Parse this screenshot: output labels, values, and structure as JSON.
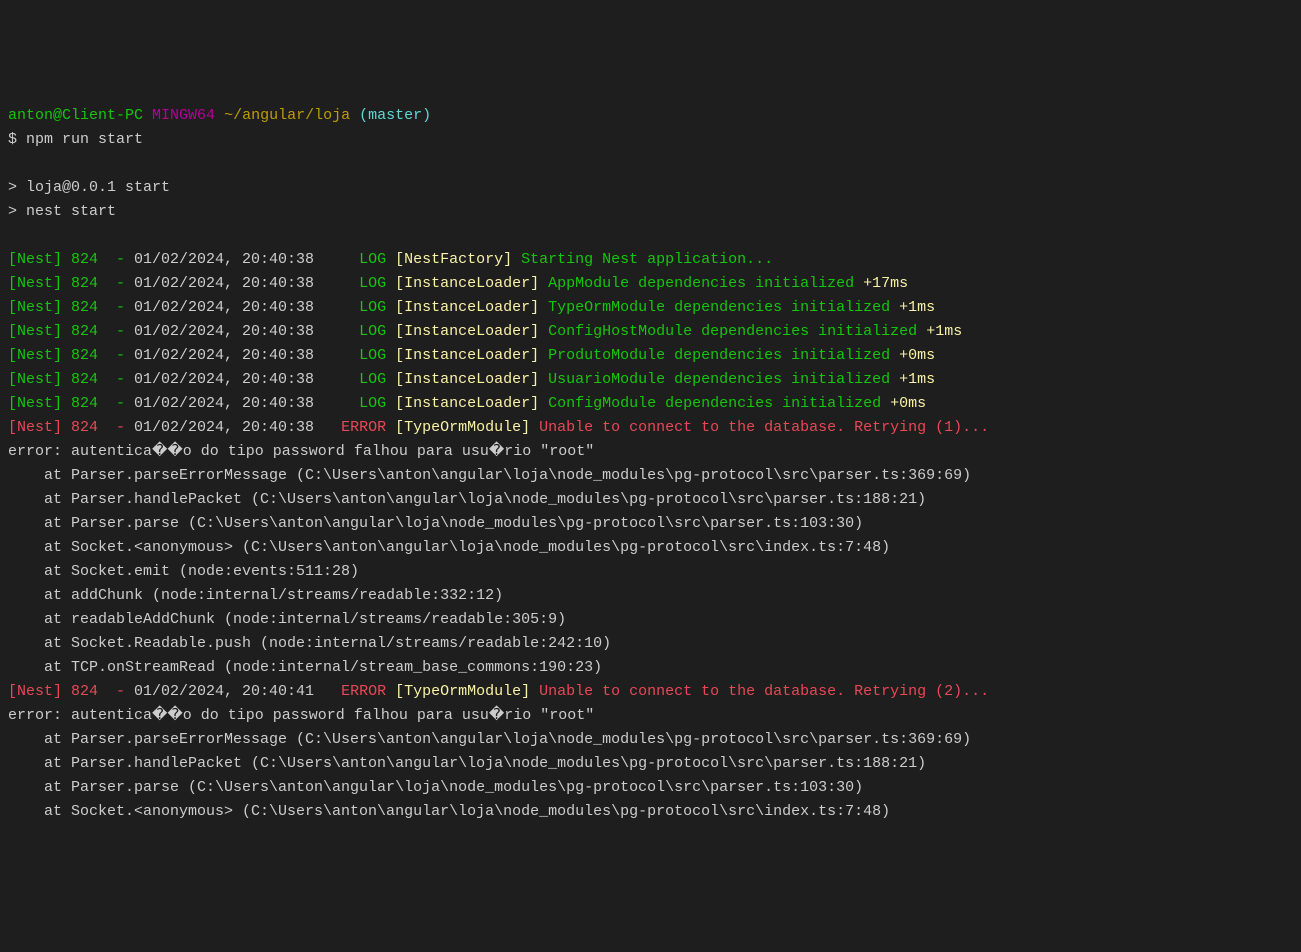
{
  "prompt": {
    "user": "anton@Client-PC",
    "mingw": "MINGW64",
    "path": "~/angular/loja",
    "branch": "(master)",
    "cmd_prefix": "$ ",
    "command": "npm run start"
  },
  "npm_output": "\n> loja@0.0.1 start\n> nest start\n",
  "logs": [
    {
      "prefix": "[Nest] 824  - ",
      "date": "01/02/2024, 20:40:38",
      "level": "     LOG ",
      "level_color": "green",
      "context": "[NestFactory]",
      "context_color": "yellow-bright",
      "msg": " Starting Nest application...",
      "msg_color": "green",
      "time": ""
    },
    {
      "prefix": "[Nest] 824  - ",
      "date": "01/02/2024, 20:40:38",
      "level": "     LOG ",
      "level_color": "green",
      "context": "[InstanceLoader]",
      "context_color": "yellow-bright",
      "msg": " AppModule dependencies initialized ",
      "msg_color": "green",
      "time": "+17ms"
    },
    {
      "prefix": "[Nest] 824  - ",
      "date": "01/02/2024, 20:40:38",
      "level": "     LOG ",
      "level_color": "green",
      "context": "[InstanceLoader]",
      "context_color": "yellow-bright",
      "msg": " TypeOrmModule dependencies initialized ",
      "msg_color": "green",
      "time": "+1ms"
    },
    {
      "prefix": "[Nest] 824  - ",
      "date": "01/02/2024, 20:40:38",
      "level": "     LOG ",
      "level_color": "green",
      "context": "[InstanceLoader]",
      "context_color": "yellow-bright",
      "msg": " ConfigHostModule dependencies initialized ",
      "msg_color": "green",
      "time": "+1ms"
    },
    {
      "prefix": "[Nest] 824  - ",
      "date": "01/02/2024, 20:40:38",
      "level": "     LOG ",
      "level_color": "green",
      "context": "[InstanceLoader]",
      "context_color": "yellow-bright",
      "msg": " ProdutoModule dependencies initialized ",
      "msg_color": "green",
      "time": "+0ms"
    },
    {
      "prefix": "[Nest] 824  - ",
      "date": "01/02/2024, 20:40:38",
      "level": "     LOG ",
      "level_color": "green",
      "context": "[InstanceLoader]",
      "context_color": "yellow-bright",
      "msg": " UsuarioModule dependencies initialized ",
      "msg_color": "green",
      "time": "+1ms"
    },
    {
      "prefix": "[Nest] 824  - ",
      "date": "01/02/2024, 20:40:38",
      "level": "     LOG ",
      "level_color": "green",
      "context": "[InstanceLoader]",
      "context_color": "yellow-bright",
      "msg": " ConfigModule dependencies initialized ",
      "msg_color": "green",
      "time": "+0ms"
    },
    {
      "prefix": "[Nest] 824  - ",
      "date": "01/02/2024, 20:40:38",
      "level": "   ERROR ",
      "level_color": "red-bright",
      "context": "[TypeOrmModule]",
      "context_color": "yellow-bright",
      "msg": " Unable to connect to the database. Retrying (1)...",
      "msg_color": "red-bright",
      "time": ""
    }
  ],
  "error_block_1": "error: autentica��o do tipo password falhou para usu�rio \"root\"\n    at Parser.parseErrorMessage (C:\\Users\\anton\\angular\\loja\\node_modules\\pg-protocol\\src\\parser.ts:369:69)\n    at Parser.handlePacket (C:\\Users\\anton\\angular\\loja\\node_modules\\pg-protocol\\src\\parser.ts:188:21)\n    at Parser.parse (C:\\Users\\anton\\angular\\loja\\node_modules\\pg-protocol\\src\\parser.ts:103:30)\n    at Socket.<anonymous> (C:\\Users\\anton\\angular\\loja\\node_modules\\pg-protocol\\src\\index.ts:7:48)\n    at Socket.emit (node:events:511:28)\n    at addChunk (node:internal/streams/readable:332:12)\n    at readableAddChunk (node:internal/streams/readable:305:9)\n    at Socket.Readable.push (node:internal/streams/readable:242:10)\n    at TCP.onStreamRead (node:internal/stream_base_commons:190:23)",
  "log_retry2": {
    "prefix": "[Nest] 824  - ",
    "date": "01/02/2024, 20:40:41",
    "level": "   ERROR ",
    "context": "[TypeOrmModule]",
    "msg": " Unable to connect to the database. Retrying (2)..."
  },
  "error_block_2": "error: autentica��o do tipo password falhou para usu�rio \"root\"\n    at Parser.parseErrorMessage (C:\\Users\\anton\\angular\\loja\\node_modules\\pg-protocol\\src\\parser.ts:369:69)\n    at Parser.handlePacket (C:\\Users\\anton\\angular\\loja\\node_modules\\pg-protocol\\src\\parser.ts:188:21)\n    at Parser.parse (C:\\Users\\anton\\angular\\loja\\node_modules\\pg-protocol\\src\\parser.ts:103:30)\n    at Socket.<anonymous> (C:\\Users\\anton\\angular\\loja\\node_modules\\pg-protocol\\src\\index.ts:7:48)"
}
